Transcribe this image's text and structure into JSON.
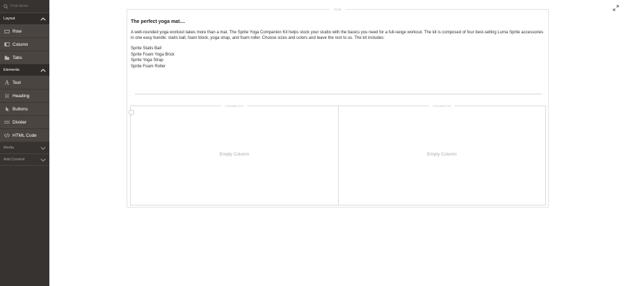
{
  "sidebar": {
    "search": {
      "placeholder": "Find Items"
    },
    "groups": [
      {
        "label": "Layout",
        "state": "expanded",
        "items": [
          {
            "label": "Row",
            "icon": "row-icon"
          },
          {
            "label": "Column",
            "icon": "column-icon"
          },
          {
            "label": "Tabs",
            "icon": "tabs-icon"
          }
        ]
      },
      {
        "label": "Elements",
        "state": "expanded",
        "items": [
          {
            "label": "Text",
            "icon": "text-icon"
          },
          {
            "label": "Heading",
            "icon": "heading-icon"
          },
          {
            "label": "Buttons",
            "icon": "buttons-icon"
          },
          {
            "label": "Divider",
            "icon": "divider-icon"
          },
          {
            "label": "HTML Code",
            "icon": "html-code-icon"
          }
        ]
      },
      {
        "label": "Media",
        "state": "collapsed",
        "items": []
      },
      {
        "label": "Add Content",
        "state": "collapsed",
        "items": []
      }
    ]
  },
  "stage": {
    "row_label": "ROW",
    "heading": "The perfect yoga mat....",
    "paragraph": "A well-rounded yoga workout takes more than a mat. The Sprite Yoga Companion Kit helps stock your studio with the basics you need for a full-range workout. The kit is composed of four best-selling Luma Sprite accessories in one easy bundle: statis ball, foam block, yoga strap, and foam roller. Choose sizes and colors and leave the rest to us. The kit includes:",
    "list": [
      "Sprite Statis Ball",
      "Sprite Foam Yoga Brick",
      "Sprite Yoga Strap",
      "Sprite Foam Roller"
    ],
    "columns": [
      {
        "label": "COLUMN 1/12",
        "empty_text": "Empty Column"
      },
      {
        "label": "COLUMN 1/12",
        "empty_text": "Empty Column"
      }
    ]
  },
  "colors": {
    "sidebar_bg": "#373330",
    "item_bg": "#4a4541",
    "border": "#e3e3e3"
  },
  "icons": {
    "search": "search-icon",
    "fullscreen": "fullscreen-icon",
    "chevron_up": "chevron-up-icon",
    "chevron_down": "chevron-down-icon"
  }
}
